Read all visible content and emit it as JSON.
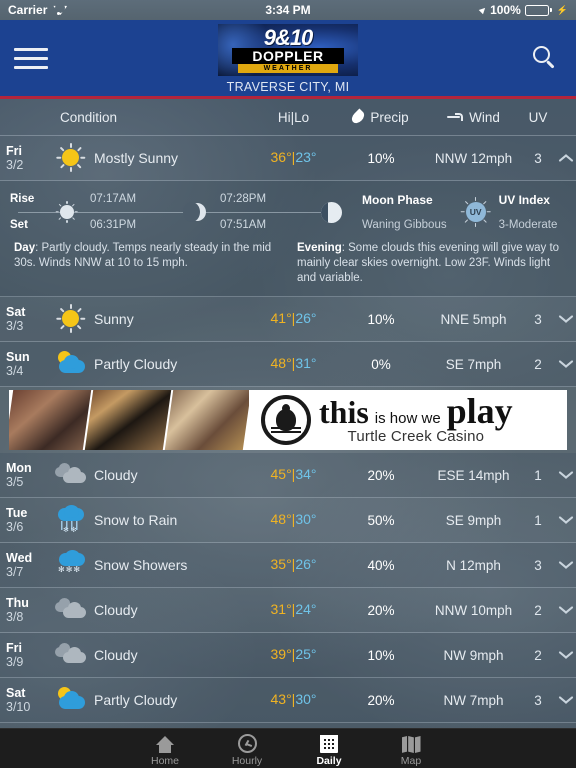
{
  "statusbar": {
    "carrier": "Carrier",
    "time": "3:34 PM",
    "battery": "100%"
  },
  "header": {
    "logo_top": "9&10",
    "logo_mid": "DOPPLER",
    "logo_bottom": "WEATHER",
    "city": "TRAVERSE CITY, MI",
    "menu_icon": "hamburger-icon",
    "search_icon": "search-icon"
  },
  "columns": {
    "condition": "Condition",
    "hilo": "Hi|Lo",
    "precip": "Precip",
    "wind": "Wind",
    "uv": "UV"
  },
  "forecast": [
    {
      "day": "Fri",
      "date": "3/2",
      "condition": "Mostly Sunny",
      "icon": "sun-icon",
      "hi": "36°",
      "lo": "23°",
      "precip": "10%",
      "wind": "NNW 12mph",
      "uv": "3",
      "expanded": true,
      "chevron": "chevron-up-icon"
    },
    {
      "day": "Sat",
      "date": "3/3",
      "condition": "Sunny",
      "icon": "sun-icon",
      "hi": "41°",
      "lo": "26°",
      "precip": "10%",
      "wind": "NNE 5mph",
      "uv": "3",
      "expanded": false,
      "chevron": "chevron-down-icon"
    },
    {
      "day": "Sun",
      "date": "3/4",
      "condition": "Partly Cloudy",
      "icon": "sun-cloud-icon",
      "hi": "48°",
      "lo": "31°",
      "precip": "0%",
      "wind": "SE 7mph",
      "uv": "2",
      "expanded": false,
      "chevron": "chevron-down-icon"
    },
    {
      "day": "Mon",
      "date": "3/5",
      "condition": "Cloudy",
      "icon": "cloudy-icon",
      "hi": "45°",
      "lo": "34°",
      "precip": "20%",
      "wind": "ESE 14mph",
      "uv": "1",
      "expanded": false,
      "chevron": "chevron-down-icon"
    },
    {
      "day": "Tue",
      "date": "3/6",
      "condition": "Snow to Rain",
      "icon": "snow-rain-icon",
      "hi": "48°",
      "lo": "30°",
      "precip": "50%",
      "wind": "SE 9mph",
      "uv": "1",
      "expanded": false,
      "chevron": "chevron-down-icon"
    },
    {
      "day": "Wed",
      "date": "3/7",
      "condition": "Snow Showers",
      "icon": "snow-showers-icon",
      "hi": "35°",
      "lo": "26°",
      "precip": "40%",
      "wind": "N 12mph",
      "uv": "3",
      "expanded": false,
      "chevron": "chevron-down-icon"
    },
    {
      "day": "Thu",
      "date": "3/8",
      "condition": "Cloudy",
      "icon": "cloudy-icon",
      "hi": "31°",
      "lo": "24°",
      "precip": "20%",
      "wind": "NNW 10mph",
      "uv": "2",
      "expanded": false,
      "chevron": "chevron-down-icon"
    },
    {
      "day": "Fri",
      "date": "3/9",
      "condition": "Cloudy",
      "icon": "cloudy-icon",
      "hi": "39°",
      "lo": "25°",
      "precip": "10%",
      "wind": "NW 9mph",
      "uv": "2",
      "expanded": false,
      "chevron": "chevron-down-icon"
    },
    {
      "day": "Sat",
      "date": "3/10",
      "condition": "Partly Cloudy",
      "icon": "sun-cloud-icon",
      "hi": "43°",
      "lo": "30°",
      "precip": "20%",
      "wind": "NW 7mph",
      "uv": "3",
      "expanded": false,
      "chevron": "chevron-down-icon"
    }
  ],
  "detail": {
    "rise_label": "Rise",
    "set_label": "Set",
    "sunrise": "07:17AM",
    "sunset": "06:31PM",
    "moonrise": "07:28PM",
    "moonset": "07:51AM",
    "moon_phase_label": "Moon Phase",
    "moon_phase_value": "Waning Gibbous",
    "uv_index_label": "UV Index",
    "uv_index_value": "3-Moderate",
    "uv_badge": "UV",
    "day_label": "Day",
    "day_text": ": Partly cloudy. Temps nearly steady in the mid 30s. Winds NNW at 10 to 15 mph.",
    "evening_label": "Evening",
    "evening_text": ": Some clouds this evening will give way to mainly clear skies overnight. Low 23F. Winds light and variable."
  },
  "ad": {
    "word_this": "this",
    "word_ishow": "is how we",
    "word_play": "play",
    "subtitle": "Turtle Creek Casino"
  },
  "tabbar": [
    {
      "label": "Home",
      "icon": "home-icon",
      "active": false
    },
    {
      "label": "Hourly",
      "icon": "clock-icon",
      "active": false
    },
    {
      "label": "Daily",
      "icon": "calendar-icon",
      "active": true
    },
    {
      "label": "Map",
      "icon": "map-icon",
      "active": false
    }
  ],
  "colors": {
    "header_blue": "#1c4291",
    "accent_red": "#b3253c",
    "hi_temp": "#f0b323",
    "lo_temp": "#6fc3e8",
    "tabbar_bg": "#1d1d1d"
  }
}
